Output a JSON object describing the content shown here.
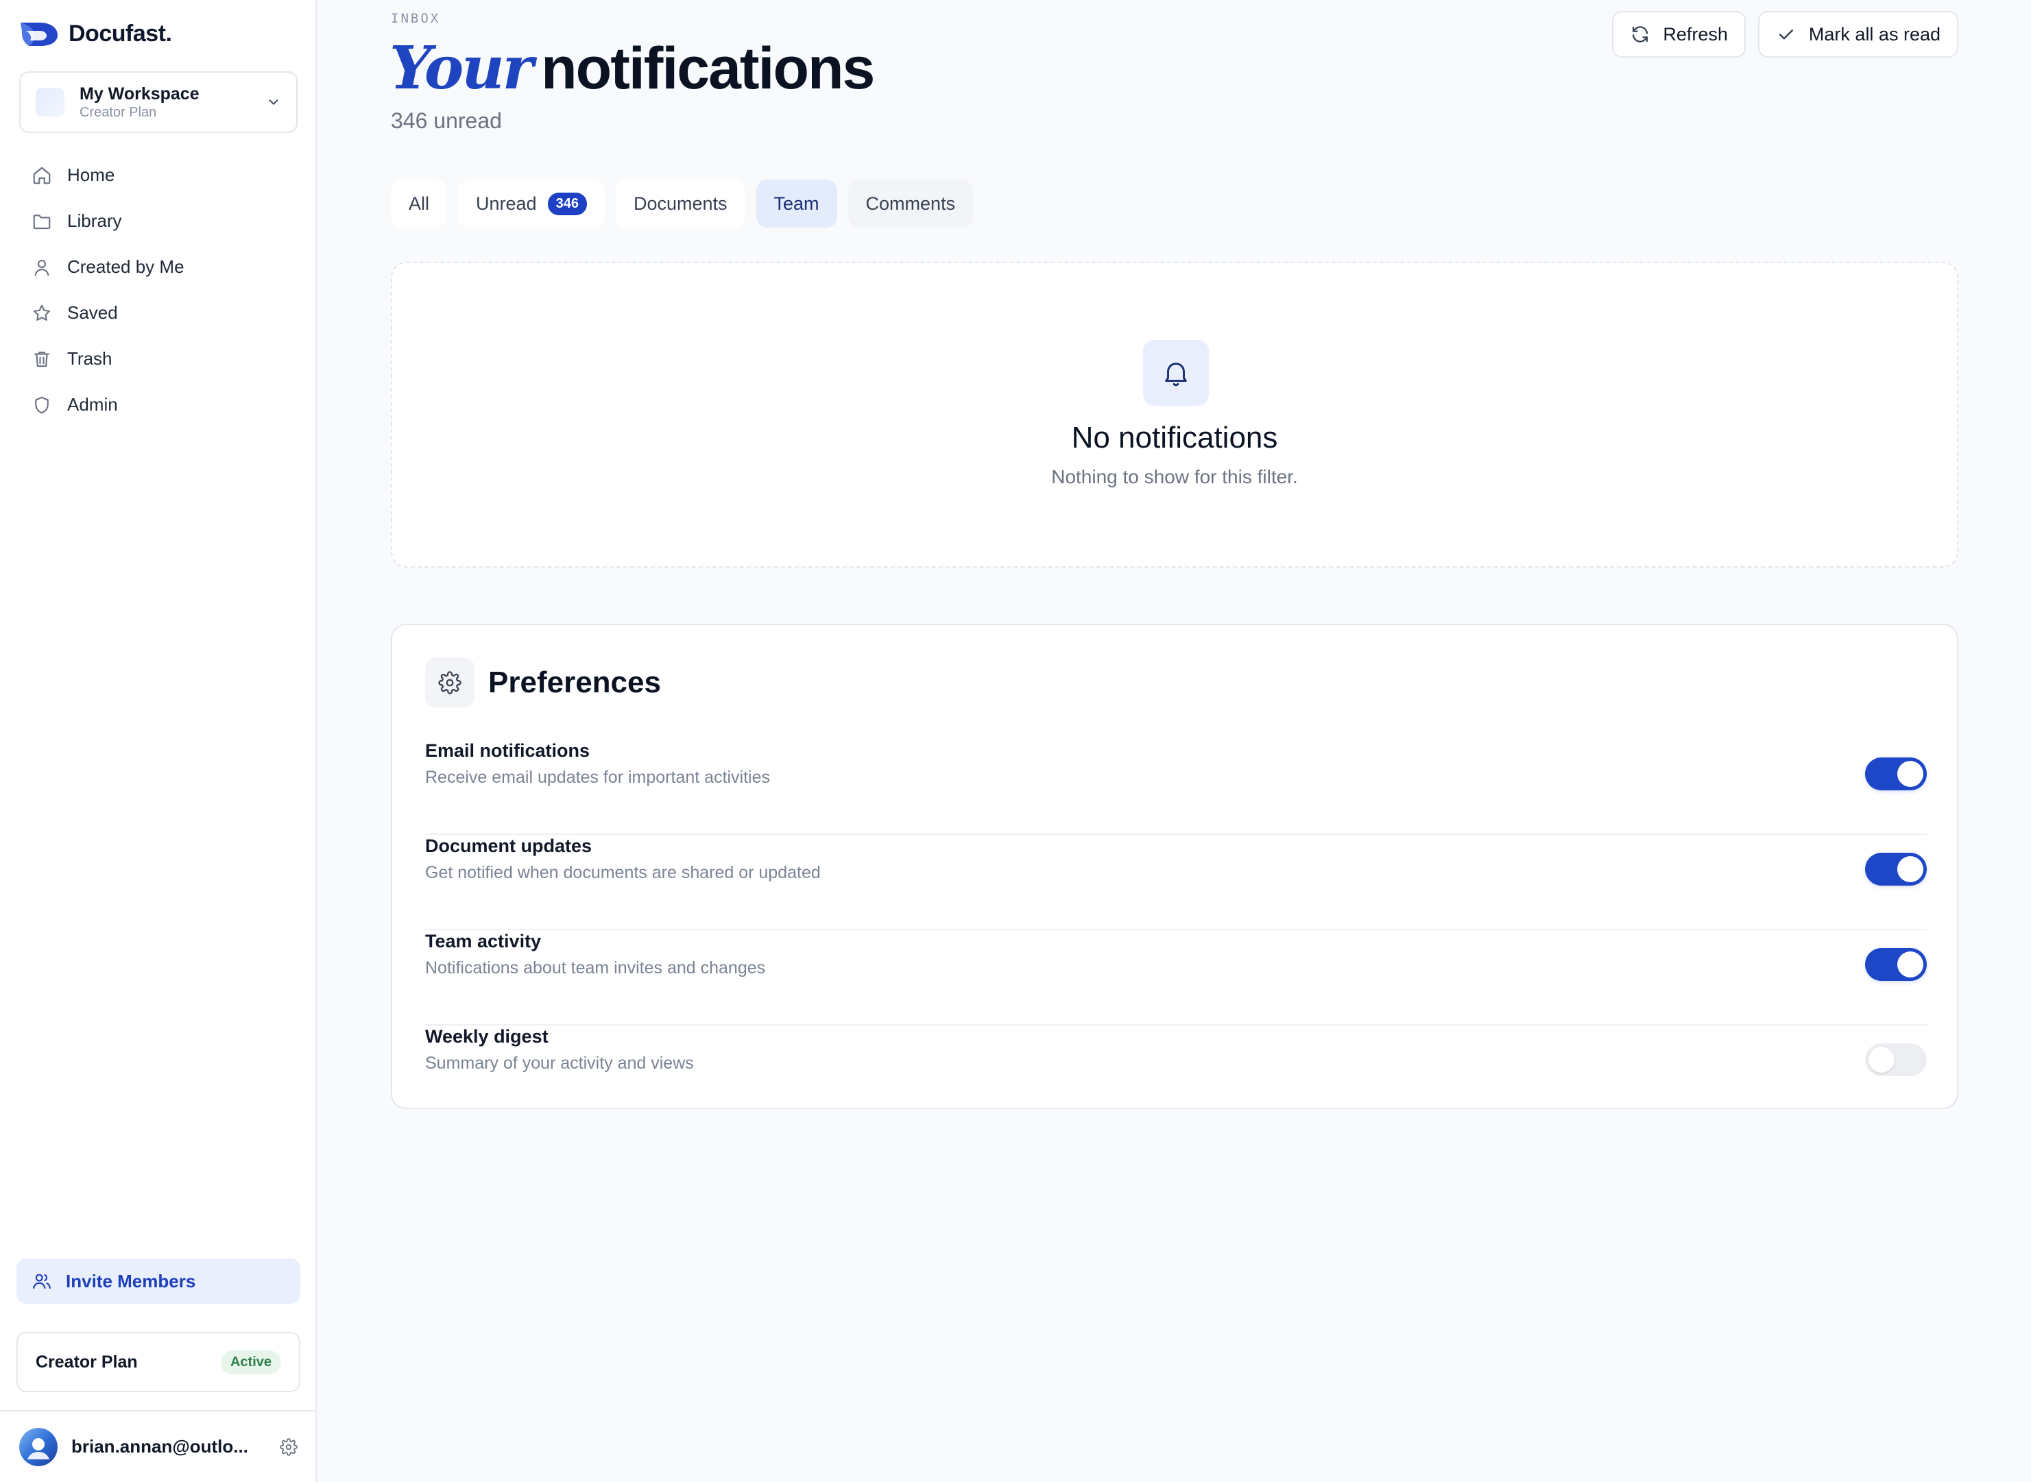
{
  "brand": {
    "name": "Docufast."
  },
  "workspace": {
    "name": "My Workspace",
    "plan": "Creator Plan"
  },
  "nav": {
    "items": [
      {
        "label": "Home",
        "icon": "home-icon"
      },
      {
        "label": "Library",
        "icon": "folder-icon"
      },
      {
        "label": "Created by Me",
        "icon": "user-icon"
      },
      {
        "label": "Saved",
        "icon": "star-icon"
      },
      {
        "label": "Trash",
        "icon": "trash-icon"
      },
      {
        "label": "Admin",
        "icon": "shield-icon"
      }
    ]
  },
  "sidebar_footer": {
    "invite_label": "Invite Members",
    "plan_name": "Creator Plan",
    "plan_status": "Active",
    "user_email": "brian.annan@outlo..."
  },
  "header": {
    "eyebrow": "INBOX",
    "title_accent": "Your",
    "title_rest": "notifications",
    "unread_text": "346 unread",
    "refresh_label": "Refresh",
    "mark_all_label": "Mark all as read"
  },
  "tabs": {
    "all": "All",
    "unread": "Unread",
    "unread_count": "346",
    "documents": "Documents",
    "team": "Team",
    "comments": "Comments",
    "active": "Team"
  },
  "empty_state": {
    "title": "No notifications",
    "subtitle": "Nothing to show for this filter."
  },
  "preferences": {
    "title": "Preferences",
    "items": [
      {
        "name": "Email notifications",
        "description": "Receive email updates for important activities",
        "enabled": true
      },
      {
        "name": "Document updates",
        "description": "Get notified when documents are shared or updated",
        "enabled": true
      },
      {
        "name": "Team activity",
        "description": "Notifications about team invites and changes",
        "enabled": true
      },
      {
        "name": "Weekly digest",
        "description": "Summary of your activity and views",
        "enabled": false
      }
    ]
  },
  "colors": {
    "accent": "#1e47c8",
    "active_tab_bg": "#e4ebfb",
    "badge_active_bg": "#e7f5ea",
    "badge_active_text": "#2f7d4a"
  }
}
